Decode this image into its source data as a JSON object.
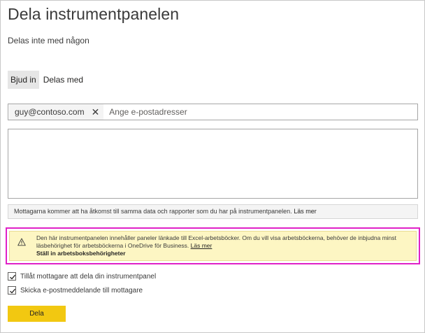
{
  "dialog": {
    "title": "Dela instrumentpanelen",
    "subtitle": "Delas inte med någon"
  },
  "tabs": [
    {
      "label": "Bjud in",
      "active": true
    },
    {
      "label": "Delas med",
      "active": false
    }
  ],
  "recipients": {
    "chips": [
      "guy@contoso.com"
    ],
    "placeholder": "Ange e-postadresser"
  },
  "message": {
    "value": ""
  },
  "info_bar": {
    "text": "Mottagarna kommer att ha åtkomst till samma data och rapporter som du har på instrumentpanelen.",
    "link": "Läs mer"
  },
  "warning": {
    "icon": "warning-triangle-icon",
    "text": "Den här instrumentpanelen innehåller paneler länkade till Excel-arbetsböcker. Om du vill visa arbetsböckerna, behöver de inbjudna minst läsbehörighet för arbetsböckerna i OneDrive för Business.",
    "link": "Läs mer",
    "action_link": "Ställ in arbetsboksbehörigheter",
    "highlight_color": "#e021c7",
    "background_color": "#fdf6c3"
  },
  "options": [
    {
      "label": "Tillåt mottagare att dela din instrumentpanel",
      "checked": true
    },
    {
      "label": "Skicka e-postmeddelande till mottagare",
      "checked": true
    }
  ],
  "actions": {
    "share_label": "Dela",
    "share_color": "#f2c811"
  }
}
